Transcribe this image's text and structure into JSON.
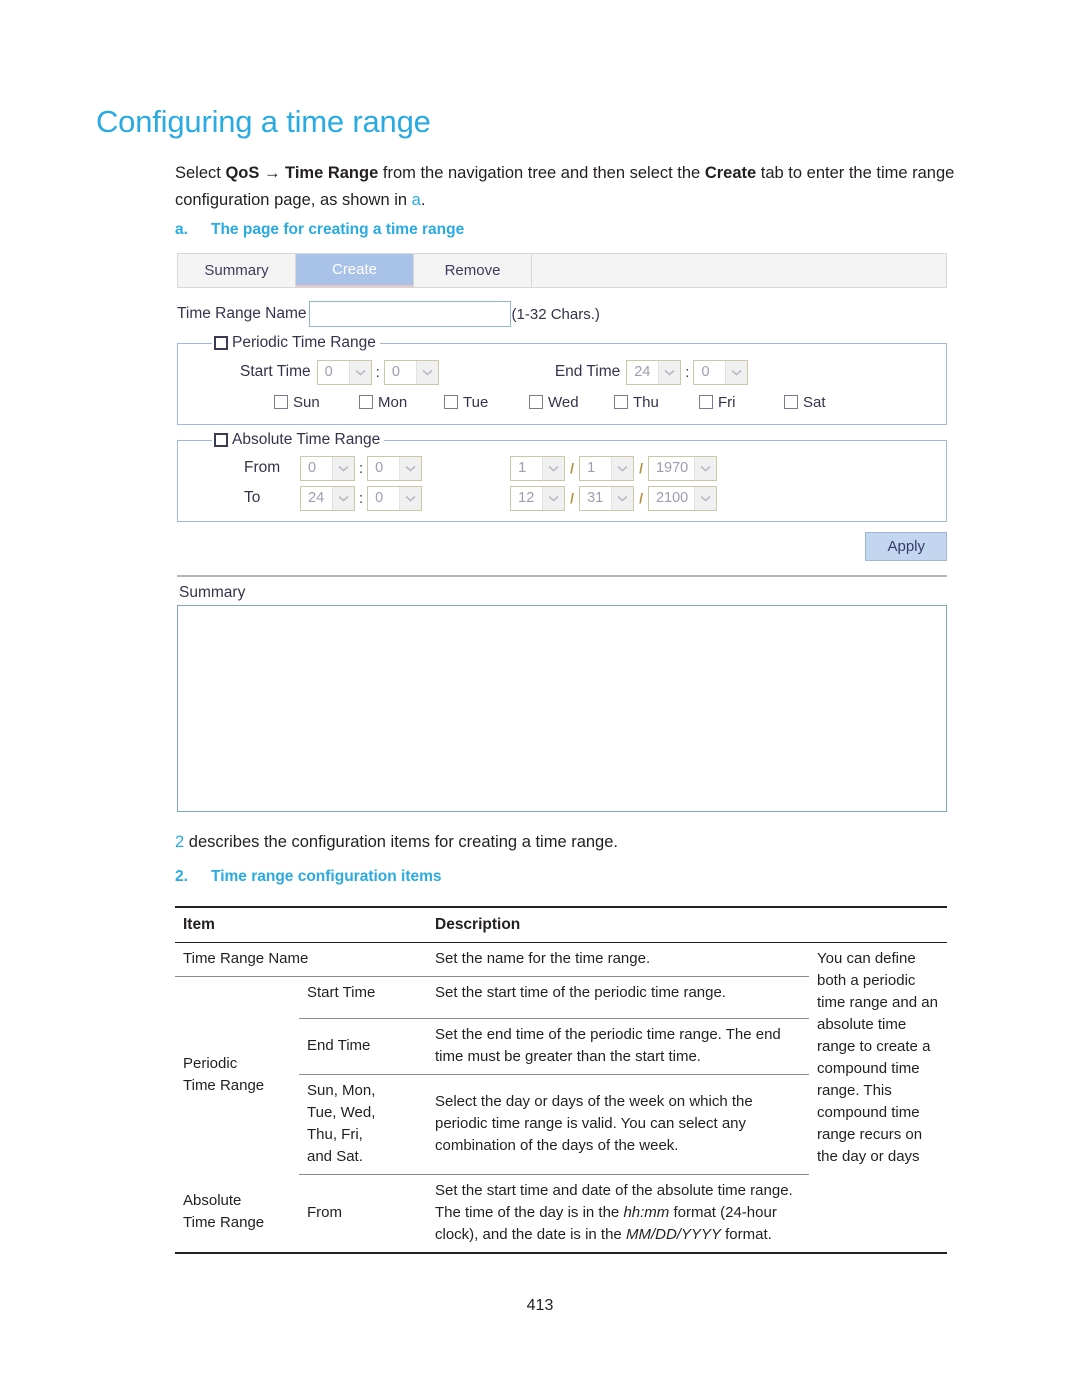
{
  "document": {
    "page_title": "Configuring a time range",
    "intro_prefix": "Select ",
    "intro_bold1": "QoS",
    "intro_arrow": " → ",
    "intro_bold2": "Time Range",
    "intro_mid": " from the navigation tree and then select the ",
    "intro_bold3": "Create",
    "intro_suffix": " tab to enter the time range configuration page, as shown in ",
    "intro_link": "a",
    "intro_end": ".",
    "figure_number": "a.",
    "figure_caption": "The page for creating a time range",
    "para2_link": "2",
    "para2_text": " describes the configuration items for creating a time range.",
    "table_number": "2.",
    "table_caption": "Time range configuration items",
    "page_number": "413"
  },
  "ui": {
    "tabs": [
      {
        "label": "Summary",
        "active": false
      },
      {
        "label": "Create",
        "active": true
      },
      {
        "label": "Remove",
        "active": false
      }
    ],
    "name_field": {
      "label": "Time Range Name",
      "value": "",
      "placeholder": "",
      "hint": "(1-32 Chars.)"
    },
    "periodic": {
      "legend": "Periodic Time Range",
      "checked": false,
      "start_label": "Start Time",
      "start_hour": "0",
      "start_minute": "0",
      "end_label": "End Time",
      "end_hour": "24",
      "end_minute": "0",
      "colon": ":",
      "days": [
        {
          "label": "Sun",
          "checked": false
        },
        {
          "label": "Mon",
          "checked": false
        },
        {
          "label": "Tue",
          "checked": false
        },
        {
          "label": "Wed",
          "checked": false
        },
        {
          "label": "Thu",
          "checked": false
        },
        {
          "label": "Fri",
          "checked": false
        },
        {
          "label": "Sat",
          "checked": false
        }
      ]
    },
    "absolute": {
      "legend": "Absolute Time Range",
      "checked": false,
      "from_label": "From",
      "from_hour": "0",
      "from_minute": "0",
      "from_month": "1",
      "from_day": "1",
      "from_year": "1970",
      "to_label": "To",
      "to_hour": "24",
      "to_minute": "0",
      "to_month": "12",
      "to_day": "31",
      "to_year": "2100",
      "colon": ":",
      "slash": "/"
    },
    "apply_label": "Apply",
    "summary_label": "Summary",
    "summary_content": ""
  },
  "table": {
    "headers": {
      "item": "Item",
      "description": "Description"
    },
    "rows": {
      "name": {
        "item": "Time Range Name",
        "description": "Set the name for the time range."
      },
      "periodic_item": "Periodic\nTime Range",
      "periodic_item_l1": "Periodic",
      "periodic_item_l2": "Time Range",
      "start_time": {
        "sub": "Start Time",
        "description": "Set the start time of the periodic time range."
      },
      "end_time": {
        "sub": "End Time",
        "description": "Set the end time of the periodic time range. The end time must be greater than the start time."
      },
      "days": {
        "sub_l1": "Sun, Mon,",
        "sub_l2": "Tue, Wed,",
        "sub_l3": "Thu, Fri,",
        "sub_l4": "and Sat.",
        "description": "Select the day or days of the week on which the periodic time range is valid. You can select any combination of the days of the week."
      },
      "absolute_item_l1": "Absolute",
      "absolute_item_l2": "Time Range",
      "absolute_from": {
        "sub": "From",
        "desc_part1": "Set the start time and date of the absolute time range. The time of the day is in the ",
        "desc_italic1": "hh:mm",
        "desc_part2": " format (24-hour clock), and the date is in the ",
        "desc_italic2": "MM/DD/YYYY",
        "desc_part3": " format."
      },
      "note": "You can define both a periodic time range and an absolute time range to create a compound time range. This compound time range recurs on the day or days"
    }
  },
  "colors": {
    "accent": "#29ABE2",
    "tab_active_bg": "#a8c2e8",
    "apply_bg": "#c2d6f0",
    "fieldset_border": "#9fb8e0",
    "input_border": "#8fb8c0"
  }
}
